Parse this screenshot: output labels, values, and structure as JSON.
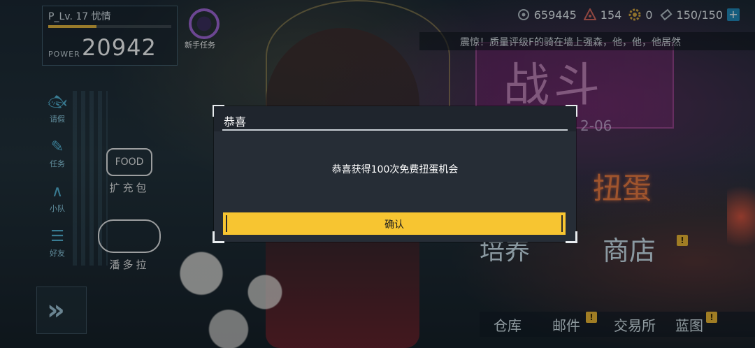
{
  "player": {
    "name": "P_Lv. 17 忧情",
    "xp_fraction": 0.39,
    "power_label": "POWER",
    "power_value": "20942"
  },
  "novice_task": {
    "label": "新手任务",
    "icon": "novice-task-icon"
  },
  "resources": [
    {
      "icon": "energy-icon",
      "value": "659445"
    },
    {
      "icon": "crystal-icon",
      "value": "154"
    },
    {
      "icon": "gear-coin-icon",
      "value": "0"
    },
    {
      "icon": "ticket-icon",
      "value": "150/150"
    }
  ],
  "add_label": "+",
  "marquee": {
    "text": "震惊！质量评级F的骑在墙上强森，他，他，他居然"
  },
  "sidebar": [
    {
      "label": "请假",
      "icon": "fish-icon"
    },
    {
      "label": "任务",
      "icon": "task-edit-icon"
    },
    {
      "label": "小队",
      "icon": "squad-icon"
    },
    {
      "label": "好友",
      "icon": "friends-icon"
    }
  ],
  "features": {
    "supply": {
      "art_text": "FOOD",
      "label": "扩充包"
    },
    "pet": {
      "label": "潘多拉"
    }
  },
  "background": {
    "fight_sign": "战斗",
    "date": "2-06"
  },
  "right_menu": {
    "gacha": "扭蛋",
    "shop": "商店",
    "archive": "培养",
    "alert": "!"
  },
  "bottom_menu": [
    {
      "label": "仓库",
      "alert": ""
    },
    {
      "label": "邮件",
      "alert": "!"
    },
    {
      "label": "交易所",
      "alert": ""
    },
    {
      "label": "蓝图",
      "alert": "!"
    }
  ],
  "dialog": {
    "title": "恭喜",
    "message": "恭喜获得100次免费扭蛋机会",
    "confirm": "确认"
  },
  "colors": {
    "accent": "#f7c531",
    "modal_bg": "#262d36",
    "sidebar": "#53b7d9"
  }
}
